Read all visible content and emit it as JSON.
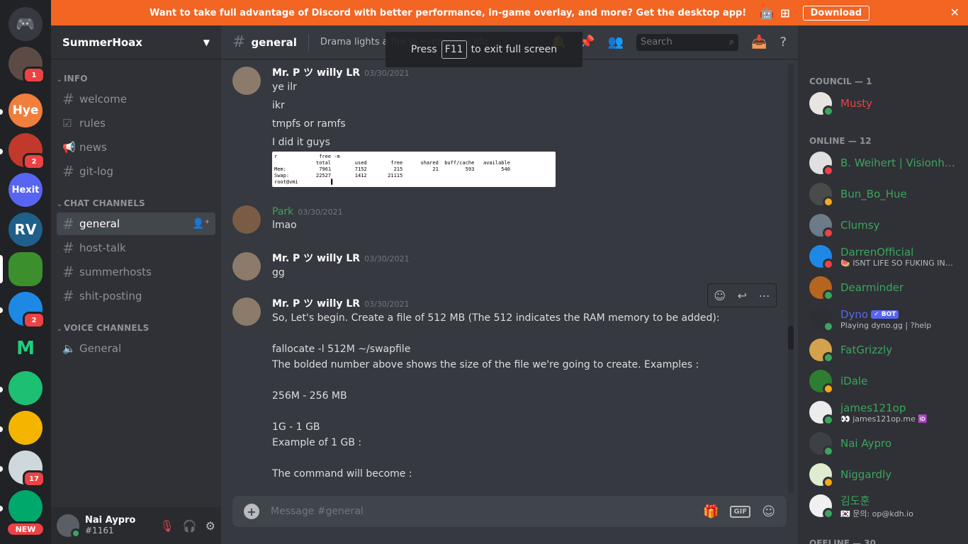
{
  "banner": {
    "text": "Want to take full advantage of Discord with better performance, in-game overlay, and more? Get the desktop app!",
    "download_label": "Download"
  },
  "servers": [
    {
      "name": "dm-home",
      "initials": "",
      "color": "#36393f"
    },
    {
      "name": "server-1",
      "initials": "",
      "color": "#5c4a44",
      "badge": "1"
    },
    {
      "name": "server-hye",
      "initials": "Hye",
      "color": "#f07e3c"
    },
    {
      "name": "server-3",
      "initials": "",
      "color": "#c0392b",
      "badge": "2"
    },
    {
      "name": "server-hexit",
      "initials": "Hexit",
      "color": "#5865f2"
    },
    {
      "name": "server-rv",
      "initials": "RV",
      "color": "#1f5f8b"
    },
    {
      "name": "server-green",
      "initials": "",
      "color": "#3b8f2c"
    },
    {
      "name": "server-8",
      "initials": "",
      "color": "#1e88e5",
      "badge": "2"
    },
    {
      "name": "server-m",
      "initials": "M",
      "color": "#202225"
    },
    {
      "name": "server-fiverr",
      "initials": "",
      "color": "#1dbf73"
    },
    {
      "name": "server-coin",
      "initials": "",
      "color": "#f4b400"
    },
    {
      "name": "server-12",
      "initials": "",
      "color": "#cfd8dc",
      "badge": "17"
    },
    {
      "name": "server-13",
      "initials": "",
      "color": "#00a86b"
    }
  ],
  "new_label": "NEW",
  "guild": {
    "name": "SummerHoax"
  },
  "categories": {
    "info": "INFO",
    "chat": "CHAT CHANNELS",
    "voice": "VOICE CHANNELS"
  },
  "channels": {
    "welcome": "welcome",
    "rules": "rules",
    "news": "news",
    "gitlog": "git-log",
    "general": "general",
    "hosttalk": "host-talk",
    "summerhosts": "summerhosts",
    "shitposting": "shit-posting",
    "voice_general": "General"
  },
  "user": {
    "name": "Nai Aypro",
    "tag": "#1161"
  },
  "header": {
    "channel": "general",
    "topic": "Drama lights a fire in everyone's life",
    "search_placeholder": "Search"
  },
  "toast": {
    "pre": "Press",
    "key": "F11",
    "post": "to exit full screen"
  },
  "messages": [
    {
      "author": "Mr. P ツ willy LR",
      "ts": "03/30/2021",
      "lines": [
        "ye ilr",
        "ikr",
        "tmpfs or ramfs",
        "I did it guys"
      ]
    },
    {
      "author": "Park",
      "ts": "03/30/2021",
      "lines": [
        "lmao"
      ]
    },
    {
      "author": "Mr. P ツ willy LR",
      "ts": "03/30/2021",
      "lines": [
        "gg"
      ]
    },
    {
      "author": "Mr. P ツ willy LR",
      "ts": "03/30/2021",
      "lines": [
        "So, Let's begin. Create a file of 512 MB (The 512 indicates the RAM memory to be added):",
        "",
        "fallocate -l 512M ~/swapfile",
        "The bolded number above shows the size of the file we're going to create. Examples :",
        "",
        "256M - 256 MB",
        "",
        "1G - 1 GB",
        "Example of 1 GB :",
        "",
        "The command will become :"
      ]
    }
  ],
  "terminal": {
    "l1": "r              free -m",
    "l2": "              total        used        free      shared  buff/cache   available",
    "l3": "Mem:           7961        7152         215          21         593         540",
    "l4": "Swap:         22527        1412       21115",
    "l5": "root@vmi           ▌"
  },
  "composer": {
    "placeholder": "Message #general",
    "gif": "GIF"
  },
  "member_groups": {
    "council": "COUNCIL — 1",
    "online": "ONLINE — 12",
    "offline": "OFFLINE — 30"
  },
  "members": [
    {
      "name": "Musty",
      "color": "#ed4245",
      "status": "#3ba55d",
      "activity": ""
    },
    {
      "name": "B. Weihert | Visionhos...",
      "color": "#3ba55d",
      "status": "#ed4245",
      "activity": ""
    },
    {
      "name": "Bun_Bo_Hue",
      "color": "#3ba55d",
      "status": "#faa81a",
      "activity": ""
    },
    {
      "name": "Clumsy",
      "color": "#3ba55d",
      "status": "#ed4245",
      "activity": ""
    },
    {
      "name": "DarrenOfficial",
      "color": "#3ba55d",
      "status": "#ed4245",
      "activity": "🍉 ISNT LIFE SO FUKING INC..."
    },
    {
      "name": "Dearminder",
      "color": "#3ba55d",
      "status": "#3ba55d",
      "activity": ""
    },
    {
      "name": "Dyno",
      "color": "#5865f2",
      "status": "#3ba55d",
      "activity": "Playing dyno.gg | ?help",
      "bot": "✓ BOT"
    },
    {
      "name": "FatGrizzly",
      "color": "#3ba55d",
      "status": "#3ba55d",
      "activity": ""
    },
    {
      "name": "iDale",
      "color": "#3ba55d",
      "status": "#faa81a",
      "activity": ""
    },
    {
      "name": "james121op",
      "color": "#3ba55d",
      "status": "#3ba55d",
      "activity": "👀 james121op.me 🆔"
    },
    {
      "name": "Nai Aypro",
      "color": "#3ba55d",
      "status": "#3ba55d",
      "activity": ""
    },
    {
      "name": "Niggardly",
      "color": "#3ba55d",
      "status": "#faa81a",
      "activity": ""
    },
    {
      "name": "김도훈",
      "color": "#3ba55d",
      "status": "#3ba55d",
      "activity": "🇰🇷 문의: op@kdh.io"
    }
  ]
}
